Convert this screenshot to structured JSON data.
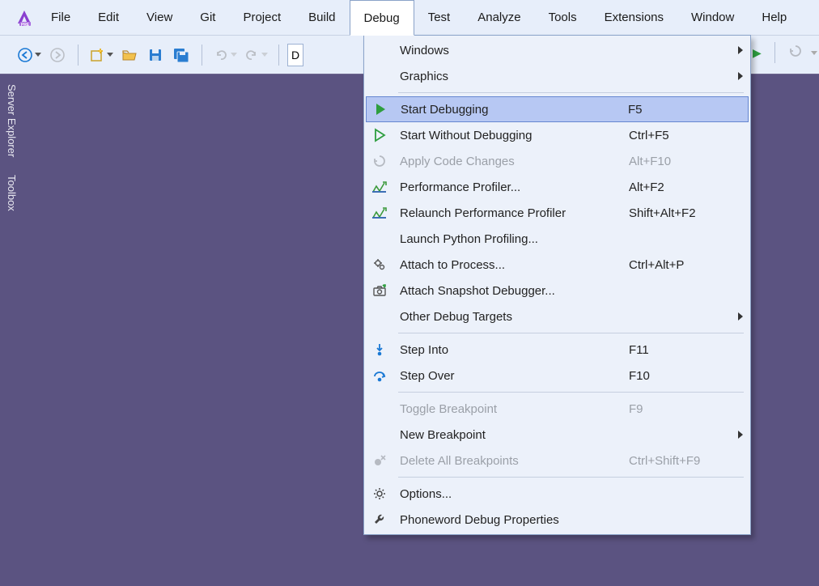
{
  "menubar": {
    "items": [
      "File",
      "Edit",
      "View",
      "Git",
      "Project",
      "Build",
      "Debug",
      "Test",
      "Analyze",
      "Tools",
      "Extensions",
      "Window",
      "Help"
    ],
    "open_index": 6
  },
  "toolbar": {
    "combo_char": "D"
  },
  "side_tabs": [
    "Server Explorer",
    "Toolbox"
  ],
  "dropdown": {
    "groups": [
      [
        {
          "label": "Windows",
          "shortcut": "",
          "submenu": true,
          "icon": "none"
        },
        {
          "label": "Graphics",
          "shortcut": "",
          "submenu": true,
          "icon": "none"
        }
      ],
      [
        {
          "label": "Start Debugging",
          "shortcut": "F5",
          "icon": "play-green",
          "highlight": true
        },
        {
          "label": "Start Without Debugging",
          "shortcut": "Ctrl+F5",
          "icon": "play-outline"
        },
        {
          "label": "Apply Code Changes",
          "shortcut": "Alt+F10",
          "icon": "swirl",
          "disabled": true
        },
        {
          "label": "Performance Profiler...",
          "shortcut": "Alt+F2",
          "icon": "perf"
        },
        {
          "label": "Relaunch Performance Profiler",
          "shortcut": "Shift+Alt+F2",
          "icon": "perf"
        },
        {
          "label": "Launch Python Profiling...",
          "shortcut": "",
          "icon": "none"
        },
        {
          "label": "Attach to Process...",
          "shortcut": "Ctrl+Alt+P",
          "icon": "gears"
        },
        {
          "label": "Attach Snapshot Debugger...",
          "shortcut": "",
          "icon": "camera"
        },
        {
          "label": "Other Debug Targets",
          "shortcut": "",
          "submenu": true,
          "icon": "none"
        }
      ],
      [
        {
          "label": "Step Into",
          "shortcut": "F11",
          "icon": "step-into"
        },
        {
          "label": "Step Over",
          "shortcut": "F10",
          "icon": "step-over"
        }
      ],
      [
        {
          "label": "Toggle Breakpoint",
          "shortcut": "F9",
          "icon": "none",
          "disabled": true
        },
        {
          "label": "New Breakpoint",
          "shortcut": "",
          "submenu": true,
          "icon": "none"
        },
        {
          "label": "Delete All Breakpoints",
          "shortcut": "Ctrl+Shift+F9",
          "icon": "del-bp",
          "disabled": true
        }
      ],
      [
        {
          "label": "Options...",
          "shortcut": "",
          "icon": "gear"
        },
        {
          "label": "Phoneword Debug Properties",
          "shortcut": "",
          "icon": "wrench"
        }
      ]
    ]
  }
}
